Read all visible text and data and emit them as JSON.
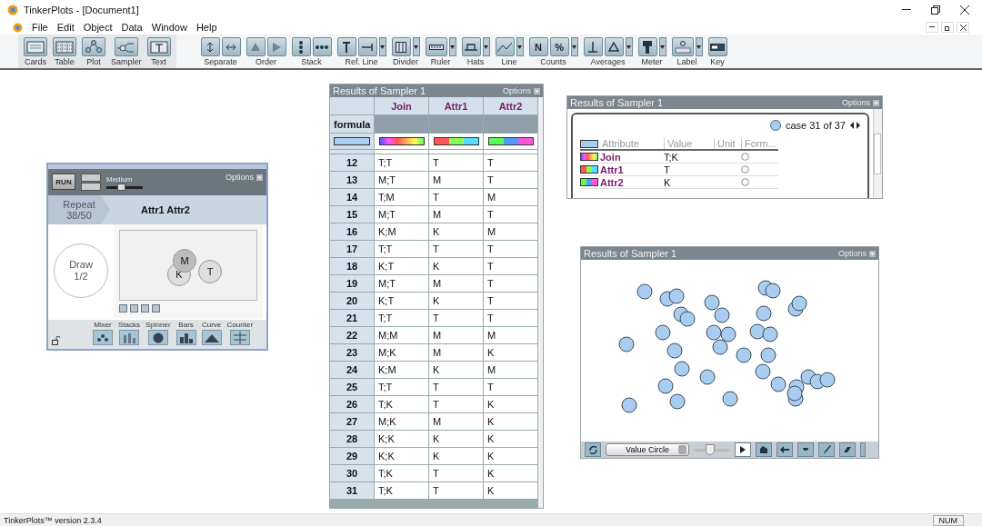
{
  "window": {
    "title": "TinkerPlots - [Document1]"
  },
  "menu": [
    "File",
    "Edit",
    "Object",
    "Data",
    "Window",
    "Help"
  ],
  "object_tools": [
    {
      "label": "Cards",
      "kind": "cards"
    },
    {
      "label": "Table",
      "kind": "table"
    },
    {
      "label": "Plot",
      "kind": "plot"
    },
    {
      "label": "Sampler",
      "kind": "sampler"
    },
    {
      "label": "Text",
      "kind": "text"
    }
  ],
  "toolbar_groups": [
    {
      "label": "Separate",
      "buttons": [
        {
          "kind": "vsep"
        },
        {
          "kind": "hsep"
        }
      ],
      "dropdown": false
    },
    {
      "label": "Order",
      "buttons": [
        {
          "kind": "up"
        },
        {
          "kind": "right"
        }
      ],
      "dropdown": false
    },
    {
      "label": "Stack",
      "buttons": [
        {
          "kind": "vstack"
        },
        {
          "kind": "hstack"
        }
      ],
      "dropdown": false
    },
    {
      "label": "Ref. Line",
      "buttons": [
        {
          "kind": "vline"
        },
        {
          "kind": "hline"
        }
      ],
      "dropdown": true
    },
    {
      "label": "Divider",
      "buttons": [
        {
          "kind": "divider"
        }
      ],
      "dropdown": true
    },
    {
      "label": "Ruler",
      "buttons": [
        {
          "kind": "ruler"
        }
      ],
      "dropdown": true
    },
    {
      "label": "Hats",
      "buttons": [
        {
          "kind": "hat"
        }
      ],
      "dropdown": true
    },
    {
      "label": "Line",
      "buttons": [
        {
          "kind": "line"
        }
      ],
      "dropdown": true
    },
    {
      "label": "Counts",
      "buttons": [
        {
          "kind": "glyph",
          "glyph": "N"
        },
        {
          "kind": "glyph",
          "glyph": "%"
        }
      ],
      "dropdown": true
    },
    {
      "label": "Averages",
      "buttons": [
        {
          "kind": "mean"
        },
        {
          "kind": "triangle"
        }
      ],
      "dropdown": true
    },
    {
      "label": "Meter",
      "buttons": [
        {
          "kind": "meter"
        }
      ],
      "dropdown": true
    },
    {
      "label": "Label",
      "buttons": [
        {
          "kind": "label"
        }
      ],
      "dropdown": true
    },
    {
      "label": "Key",
      "buttons": [
        {
          "kind": "key"
        }
      ],
      "dropdown": false
    }
  ],
  "sampler": {
    "run": "RUN",
    "speed": {
      "label": "Medium",
      "level": 0.4
    },
    "options": "Options",
    "repeat_label": "Repeat",
    "repeat_count": "38/50",
    "attributes": "Attr1 Attr2",
    "draw_label": "Draw",
    "draw_count": "1/2",
    "balls": [
      {
        "label": "M",
        "selected": true
      },
      {
        "label": "K",
        "selected": false
      },
      {
        "label": "T",
        "selected": false
      }
    ],
    "devices": [
      {
        "label": "Mixer",
        "kind": "mixer"
      },
      {
        "label": "Stacks",
        "kind": "stacks"
      },
      {
        "label": "Spinner",
        "kind": "spinner"
      },
      {
        "label": "Bars",
        "kind": "bars"
      },
      {
        "label": "Curve",
        "kind": "curve"
      },
      {
        "label": "Counter",
        "kind": "counter"
      }
    ]
  },
  "table": {
    "title": "Results of Sampler 1",
    "options": "Options",
    "formula_label": "formula",
    "columns": [
      "Join",
      "Attr1",
      "Attr2"
    ],
    "rows": [
      {
        "index": "12",
        "cells": [
          "T;T",
          "T",
          "T"
        ]
      },
      {
        "index": "13",
        "cells": [
          "M;T",
          "M",
          "T"
        ]
      },
      {
        "index": "14",
        "cells": [
          "T;M",
          "T",
          "M"
        ]
      },
      {
        "index": "15",
        "cells": [
          "M;T",
          "M",
          "T"
        ]
      },
      {
        "index": "16",
        "cells": [
          "K;M",
          "K",
          "M"
        ]
      },
      {
        "index": "17",
        "cells": [
          "T;T",
          "T",
          "T"
        ]
      },
      {
        "index": "18",
        "cells": [
          "K;T",
          "K",
          "T"
        ]
      },
      {
        "index": "19",
        "cells": [
          "M;T",
          "M",
          "T"
        ]
      },
      {
        "index": "20",
        "cells": [
          "K;T",
          "K",
          "T"
        ]
      },
      {
        "index": "21",
        "cells": [
          "T;T",
          "T",
          "T"
        ]
      },
      {
        "index": "22",
        "cells": [
          "M;M",
          "M",
          "M"
        ]
      },
      {
        "index": "23",
        "cells": [
          "M;K",
          "M",
          "K"
        ]
      },
      {
        "index": "24",
        "cells": [
          "K;M",
          "K",
          "M"
        ]
      },
      {
        "index": "25",
        "cells": [
          "T;T",
          "T",
          "T"
        ]
      },
      {
        "index": "26",
        "cells": [
          "T;K",
          "T",
          "K"
        ]
      },
      {
        "index": "27",
        "cells": [
          "M;K",
          "M",
          "K"
        ]
      },
      {
        "index": "28",
        "cells": [
          "K;K",
          "K",
          "K"
        ]
      },
      {
        "index": "29",
        "cells": [
          "K;K",
          "K",
          "K"
        ]
      },
      {
        "index": "30",
        "cells": [
          "T;K",
          "T",
          "K"
        ]
      },
      {
        "index": "31",
        "cells": [
          "T;K",
          "T",
          "K"
        ]
      }
    ]
  },
  "case_card": {
    "title": "Results of Sampler 1",
    "options": "Options",
    "case": "case 31 of 37",
    "headers": [
      "Attribute",
      "Value",
      "Unit",
      "Form..."
    ],
    "rows": [
      {
        "attribute": "Join",
        "value": "T;K"
      },
      {
        "attribute": "Attr1",
        "value": "T"
      },
      {
        "attribute": "Attr2",
        "value": "K"
      }
    ]
  },
  "plot": {
    "title": "Results of Sampler 1",
    "options": "Options",
    "icon_type": "Value Circle",
    "icon_size": {
      "level": 0.45
    }
  },
  "status_bar": {
    "version": "TinkerPlots™ version 2.3.4",
    "num": "NUM"
  }
}
